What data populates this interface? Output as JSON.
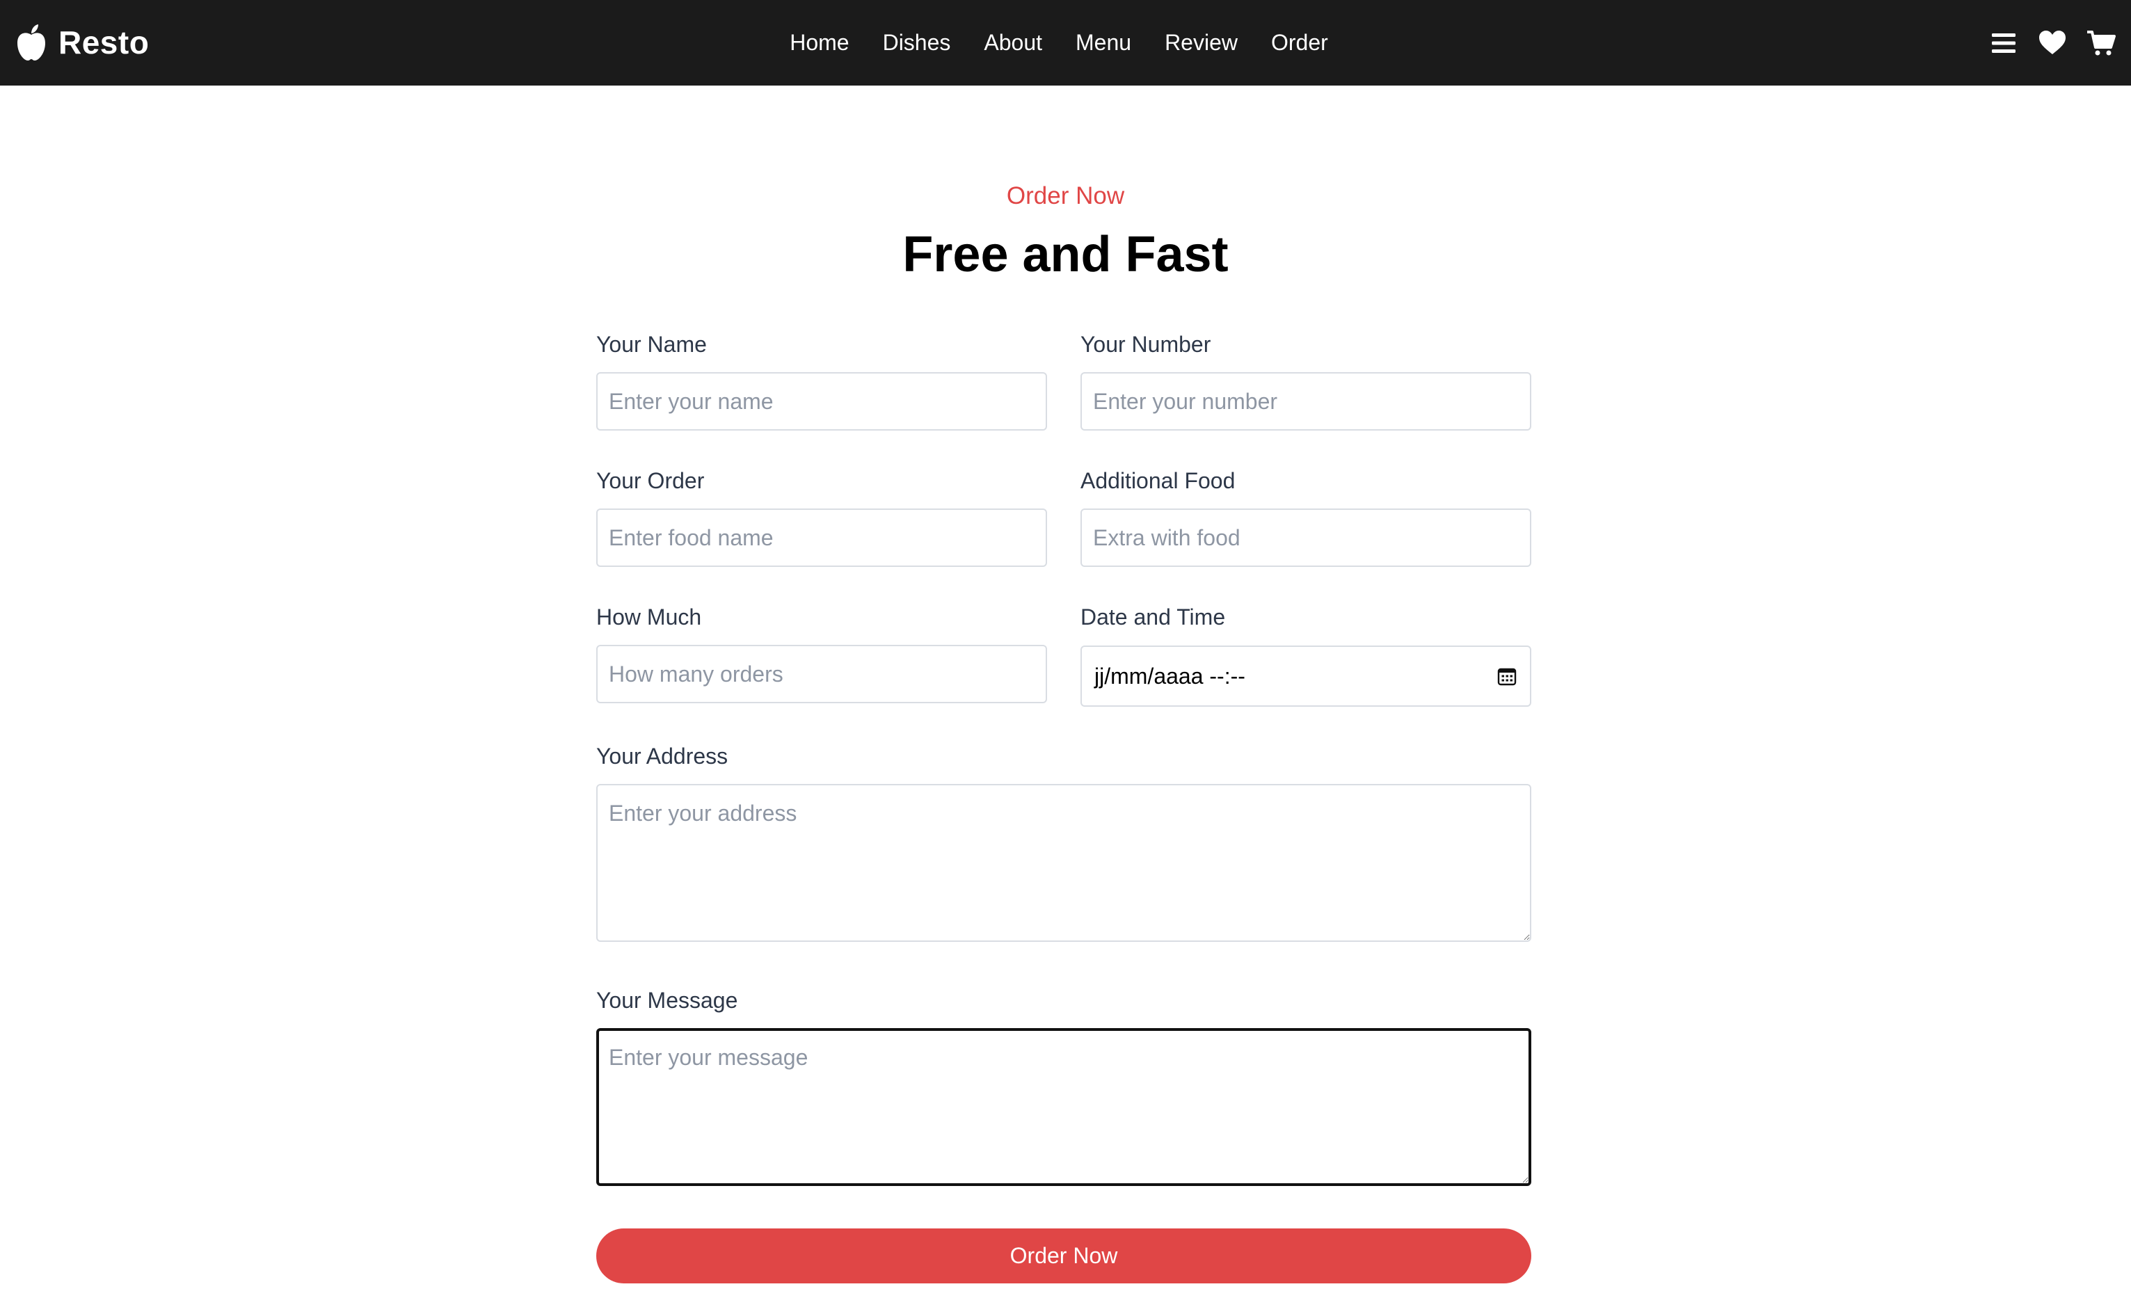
{
  "brand": {
    "name": "Resto",
    "icon": "apple-icon"
  },
  "nav": {
    "links": [
      {
        "label": "Home"
      },
      {
        "label": "Dishes"
      },
      {
        "label": "About"
      },
      {
        "label": "Menu"
      },
      {
        "label": "Review"
      },
      {
        "label": "Order"
      }
    ],
    "icons": [
      "menu-bars-icon",
      "heart-icon",
      "shopping-cart-icon"
    ]
  },
  "order": {
    "subtitle": "Order Now",
    "title": "Free and Fast",
    "fields": {
      "name": {
        "label": "Your Name",
        "placeholder": "Enter your name",
        "value": ""
      },
      "number": {
        "label": "Your Number",
        "placeholder": "Enter your number",
        "value": ""
      },
      "order": {
        "label": "Your Order",
        "placeholder": "Enter food name",
        "value": ""
      },
      "additional": {
        "label": "Additional Food",
        "placeholder": "Extra with food",
        "value": ""
      },
      "quantity": {
        "label": "How Much",
        "placeholder": "How many orders",
        "value": ""
      },
      "datetime": {
        "label": "Date and Time",
        "value": "jj/mm/aaaa  --:--"
      },
      "address": {
        "label": "Your Address",
        "placeholder": "Enter your address",
        "value": ""
      },
      "message": {
        "label": "Your Message",
        "placeholder": "Enter your message",
        "value": ""
      }
    },
    "submit_label": "Order Now"
  },
  "colors": {
    "accent": "#e04646",
    "navbar_bg": "#1b1b1b",
    "input_border": "#d9dde3",
    "placeholder": "#8e96a3"
  }
}
